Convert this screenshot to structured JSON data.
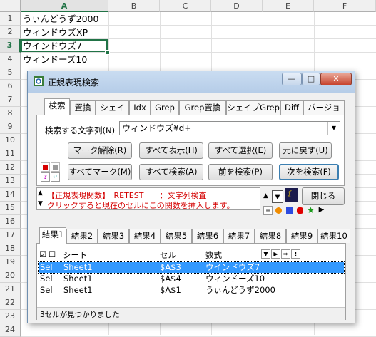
{
  "sheet": {
    "columns": [
      "A",
      "B",
      "C",
      "D",
      "E",
      "F"
    ],
    "rows": [
      "1",
      "2",
      "3",
      "4",
      "5",
      "6",
      "7",
      "8",
      "9",
      "10",
      "11",
      "12",
      "13",
      "14",
      "15",
      "16",
      "17",
      "18",
      "19",
      "20",
      "21",
      "22",
      "23",
      "24"
    ],
    "cells": [
      "うぃんどうず2000",
      "ウィンドウズXP",
      "ウインドウズ7",
      "ウィンドーズ10"
    ]
  },
  "dialog": {
    "title": "正規表現検索",
    "window_buttons": [
      "—",
      "□",
      "✕"
    ],
    "tabs": [
      "検索",
      "置換",
      "シェイプ",
      "Idx",
      "Grep",
      "Grep置換",
      "シェイプGrep",
      "Diff",
      "バージョン"
    ],
    "search_label": "検索する文字列(N)",
    "search_value": "ウィンドウズ¥d+",
    "buttons": {
      "unmark": "マーク解除(R)",
      "show_all": "すべて表示(H)",
      "select_all": "すべて選択(E)",
      "restore": "元に戻す(U)",
      "mark_all": "すべてマーク(M)",
      "search_all": "すべて検索(A)",
      "find_prev": "前を検索(P)",
      "find_next": "次を検索(F)",
      "close": "閉じる"
    },
    "hint_line1": "【正規表現関数】　RETEST　　：文字列検査",
    "hint_line2": "クリックすると現在のセルにこの関数を挿入します。",
    "result_tabs": [
      "結果1",
      "結果2",
      "結果3",
      "結果4",
      "結果5",
      "結果6",
      "結果7",
      "結果8",
      "結果9",
      "結果10"
    ],
    "result_headers": {
      "check": "☑",
      "x": "☐",
      "sheet": "シート",
      "cell": "セル",
      "formula": "数式"
    },
    "results": [
      {
        "type": "Sel",
        "sheet": "Sheet1",
        "cell": "$A$3",
        "formula": "ウインドウズ7"
      },
      {
        "type": "Sel",
        "sheet": "Sheet1",
        "cell": "$A$4",
        "formula": "ウィンドーズ10"
      },
      {
        "type": "Sel",
        "sheet": "Sheet1",
        "cell": "$A$1",
        "formula": "うぃんどうず2000"
      }
    ],
    "status": "3セルが見つかりました",
    "colors": {
      "accent": "#3399ff",
      "hint": "#d40000",
      "excel_green": "#217346"
    }
  }
}
